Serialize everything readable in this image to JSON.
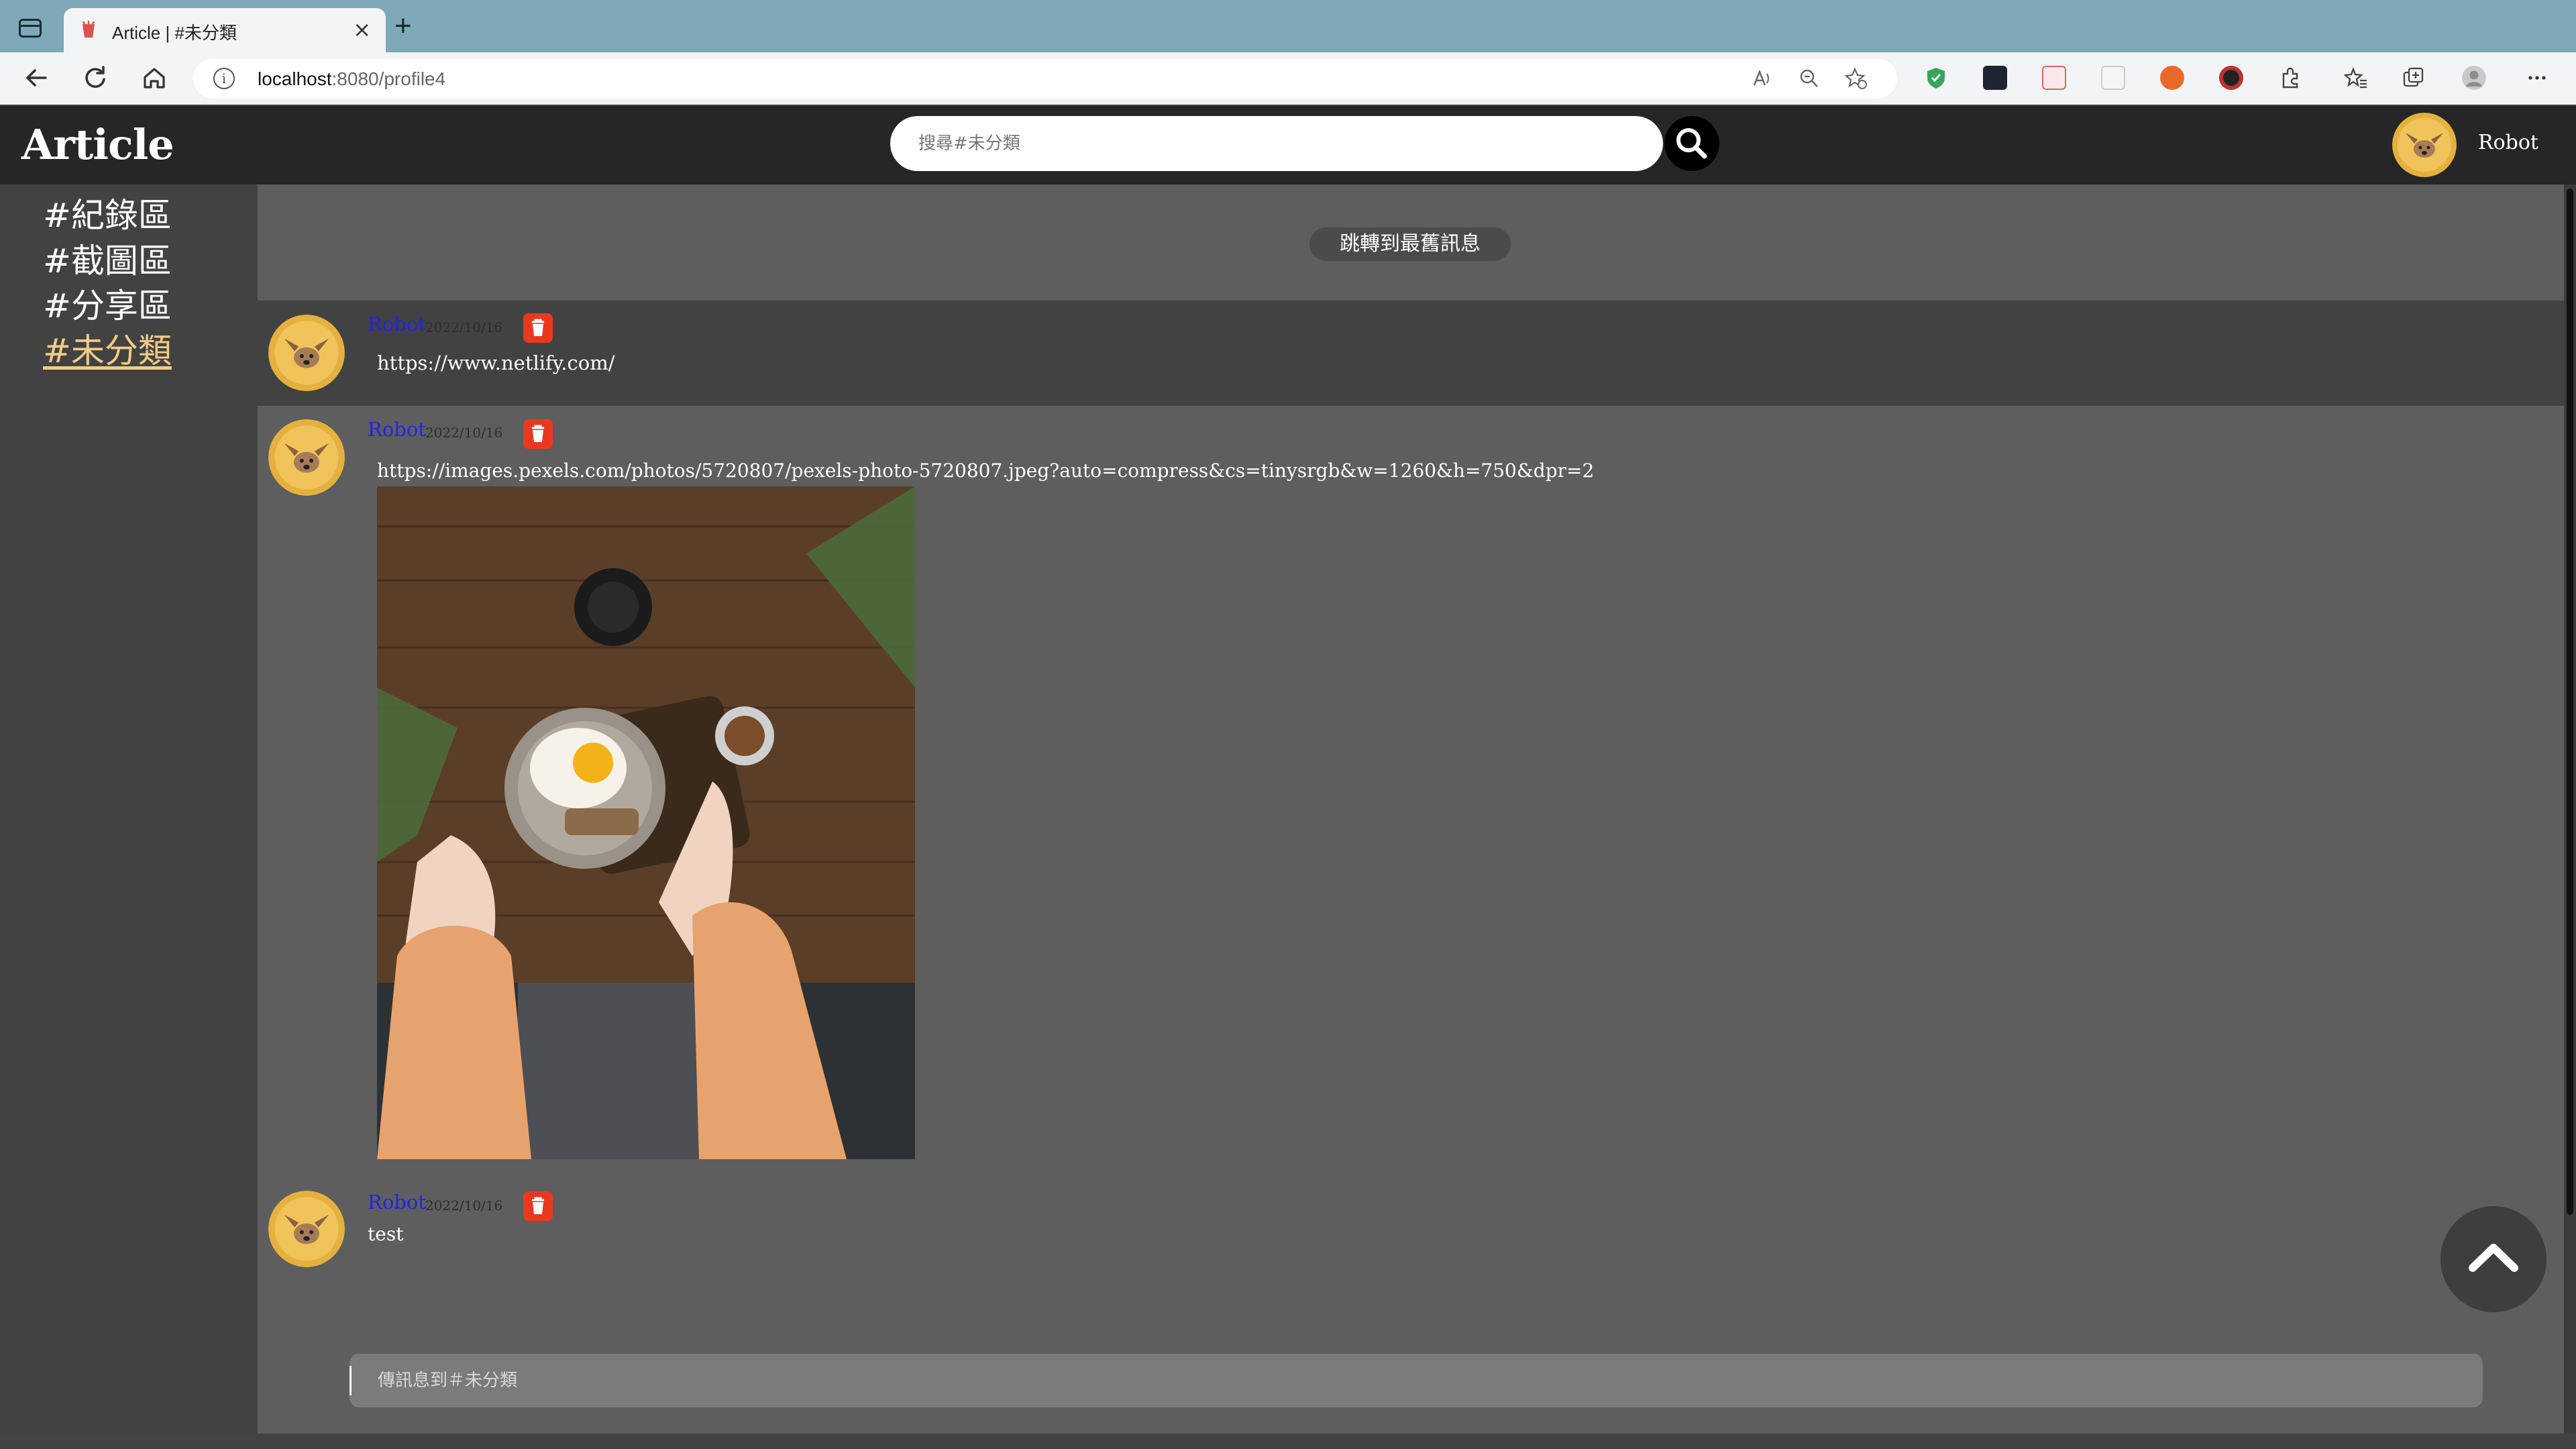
{
  "browser": {
    "tab_title": "Article | #未分類",
    "close_symbol": "×",
    "new_tab_symbol": "+",
    "url_host": "localhost",
    "url_path": ":8080/profile4",
    "info_symbol": "i"
  },
  "header": {
    "logo": "Article",
    "search_placeholder": "搜尋#未分類",
    "user_name": "Robot"
  },
  "sidebar": {
    "items": [
      {
        "label": "#紀錄區",
        "active": false
      },
      {
        "label": "#截圖區",
        "active": false
      },
      {
        "label": "#分享區",
        "active": false
      },
      {
        "label": "#未分類",
        "active": true
      }
    ]
  },
  "main": {
    "jump_label": "跳轉到最舊訊息",
    "messages": [
      {
        "author": "Robot",
        "date": "2022/10/16",
        "text": "https://www.netlify.com/"
      },
      {
        "author": "Robot",
        "date": "2022/10/16",
        "text": "https://images.pexels.com/photos/5720807/pexels-photo-5720807.jpeg?auto=compress&cs=tinysrgb&w=1260&h=750&dpr=2"
      },
      {
        "author": "Robot",
        "date": "2022/10/16",
        "text": "test"
      }
    ]
  },
  "composer": {
    "placeholder": "傳訊息到＃未分類"
  },
  "colors": {
    "header_bg": "#262626",
    "sidebar_bg": "#424242",
    "main_bg": "#5e5e5e",
    "author_blue": "#2222e8",
    "delete_red": "#e8391f",
    "active_channel": "#f2cb85"
  }
}
